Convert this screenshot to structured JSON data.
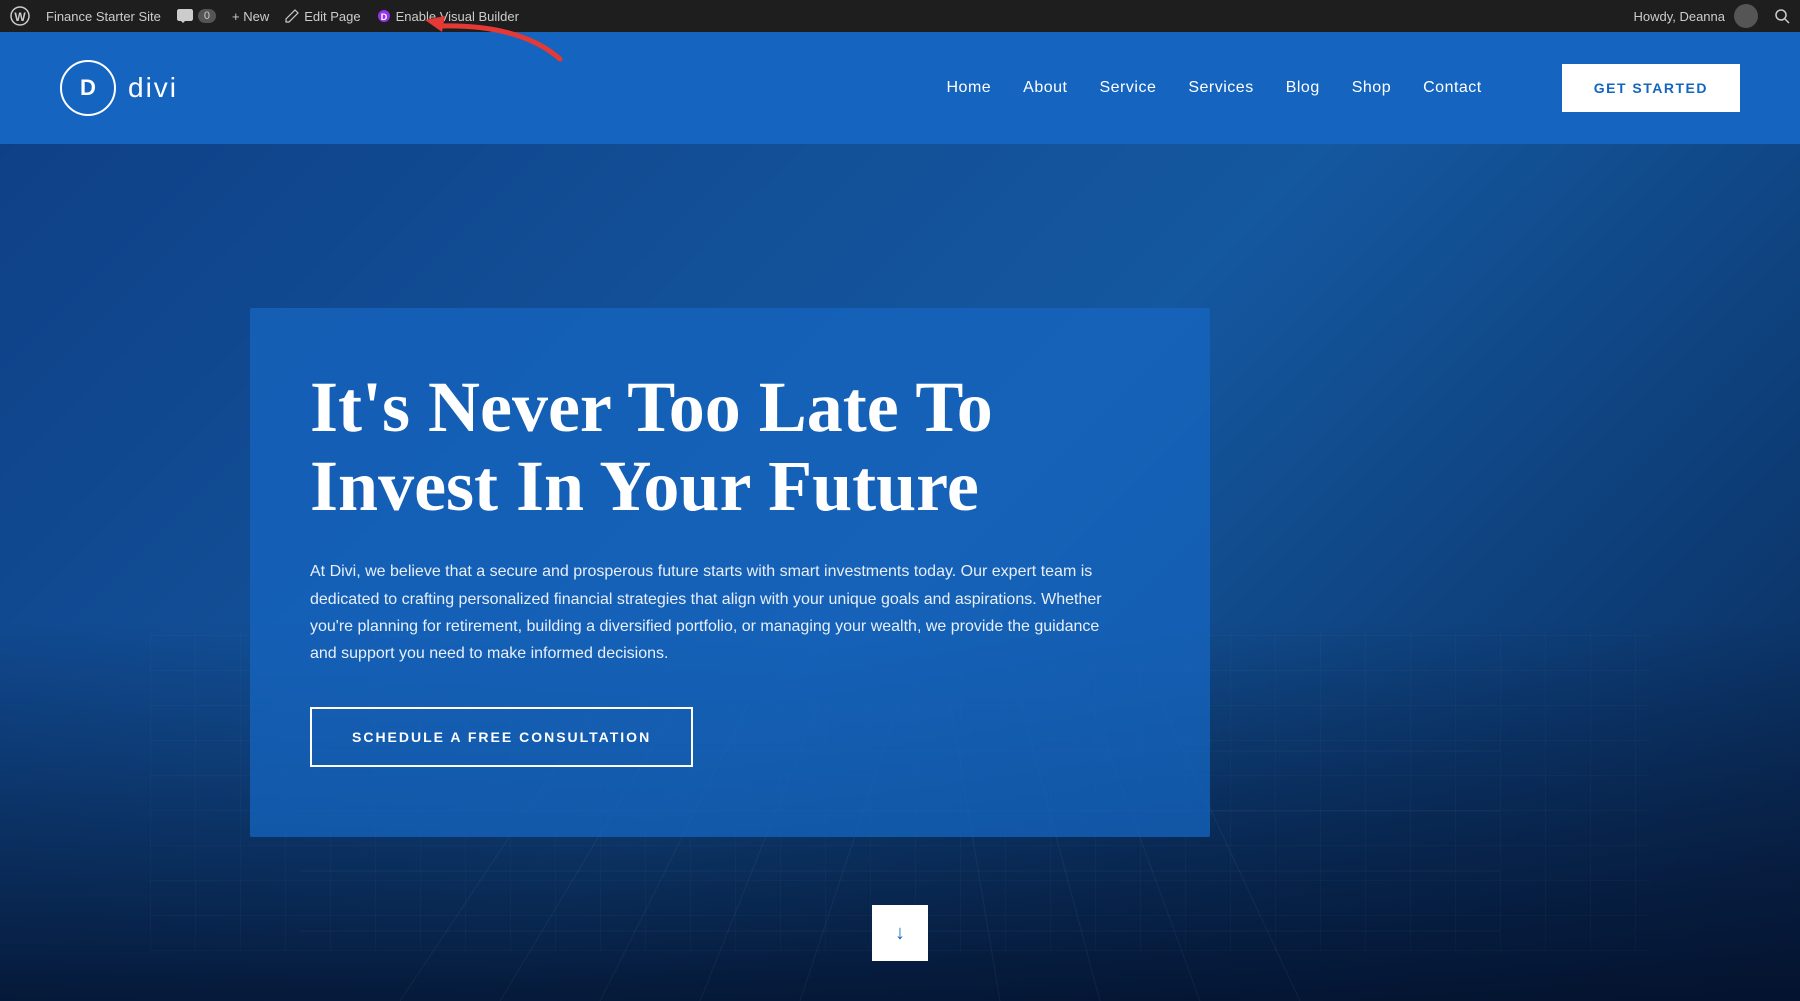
{
  "admin_bar": {
    "wp_icon_label": "WordPress",
    "site_name": "Finance Starter Site",
    "comments_label": "Comments",
    "comment_count": "0",
    "new_label": "+ New",
    "edit_page_label": "Edit Page",
    "enable_visual_builder_label": "Enable Visual Builder",
    "howdy_label": "Howdy, Deanna",
    "search_icon_label": "Search"
  },
  "header": {
    "logo_letter": "D",
    "logo_text": "divi",
    "nav_items": [
      {
        "label": "Home",
        "id": "nav-home"
      },
      {
        "label": "About",
        "id": "nav-about"
      },
      {
        "label": "Service",
        "id": "nav-service"
      },
      {
        "label": "Services",
        "id": "nav-services"
      },
      {
        "label": "Blog",
        "id": "nav-blog"
      },
      {
        "label": "Shop",
        "id": "nav-shop"
      },
      {
        "label": "Contact",
        "id": "nav-contact"
      }
    ],
    "cta_button": "GET STARTED"
  },
  "hero": {
    "title_line1": "It's Never Too Late To",
    "title_line2": "Invest In Your Future",
    "description": "At Divi, we believe that a secure and prosperous future starts with smart investments today. Our expert team is dedicated to crafting personalized financial strategies that align with your unique goals and aspirations. Whether you're planning for retirement, building a diversified portfolio, or managing your wealth, we provide the guidance and support you need to make informed decisions.",
    "cta_button": "SCHEDULE A FREE CONSULTATION",
    "scroll_down_label": "Scroll Down"
  },
  "colors": {
    "nav_bg": "#1565c0",
    "hero_bg": "#1976d2",
    "admin_bg": "#1e1e1e",
    "accent": "#1565c0"
  }
}
